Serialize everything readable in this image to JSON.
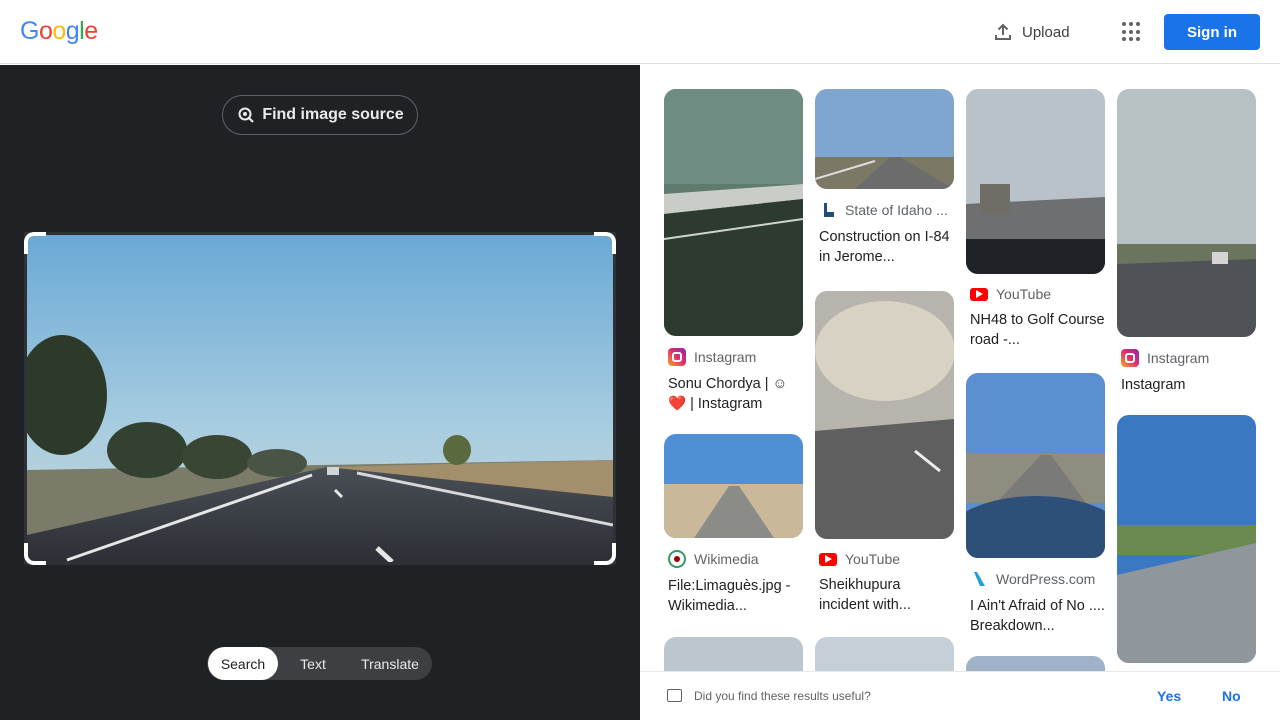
{
  "header": {
    "logo": [
      "G",
      "o",
      "o",
      "g",
      "l",
      "e"
    ],
    "logo_colors": [
      "#4285F4",
      "#EA4335",
      "#FBBC05",
      "#4285F4",
      "#34A853",
      "#EA4335"
    ],
    "upload_label": "Upload",
    "signin_label": "Sign in"
  },
  "left_panel": {
    "find_source_label": "Find image source",
    "modes": [
      {
        "label": "Search",
        "active": true
      },
      {
        "label": "Text",
        "active": false
      },
      {
        "label": "Translate",
        "active": false
      }
    ]
  },
  "results": [
    {
      "source": "Instagram",
      "source_icon": "instagram-icon",
      "title": "Sonu Chordya | ☺ ❤️ | Instagram"
    },
    {
      "source": "Wikimedia",
      "source_icon": "wikimedia-icon",
      "title": "File:Limaguès.jpg - Wikimedia..."
    },
    {
      "source": "State of Idaho ...",
      "source_icon": "idaho-icon",
      "title": "Construction on I-84 in Jerome..."
    },
    {
      "source": "YouTube",
      "source_icon": "youtube-icon",
      "title": "Sheikhupura incident with..."
    },
    {
      "source": "YouTube",
      "source_icon": "youtube-icon",
      "title": "NH48 to Golf Course road -..."
    },
    {
      "source": "WordPress.com",
      "source_icon": "wordpress-icon",
      "title": "I Ain't Afraid of No .... Breakdown..."
    },
    {
      "source": "Instagram",
      "source_icon": "instagram-icon",
      "title": "Instagram"
    }
  ],
  "feedback": {
    "question": "Did you find these results useful?",
    "yes_label": "Yes",
    "no_label": "No"
  },
  "colors": {
    "accent": "#1a73e8",
    "dark_panel": "#202124",
    "youtube": "#FF0000"
  }
}
